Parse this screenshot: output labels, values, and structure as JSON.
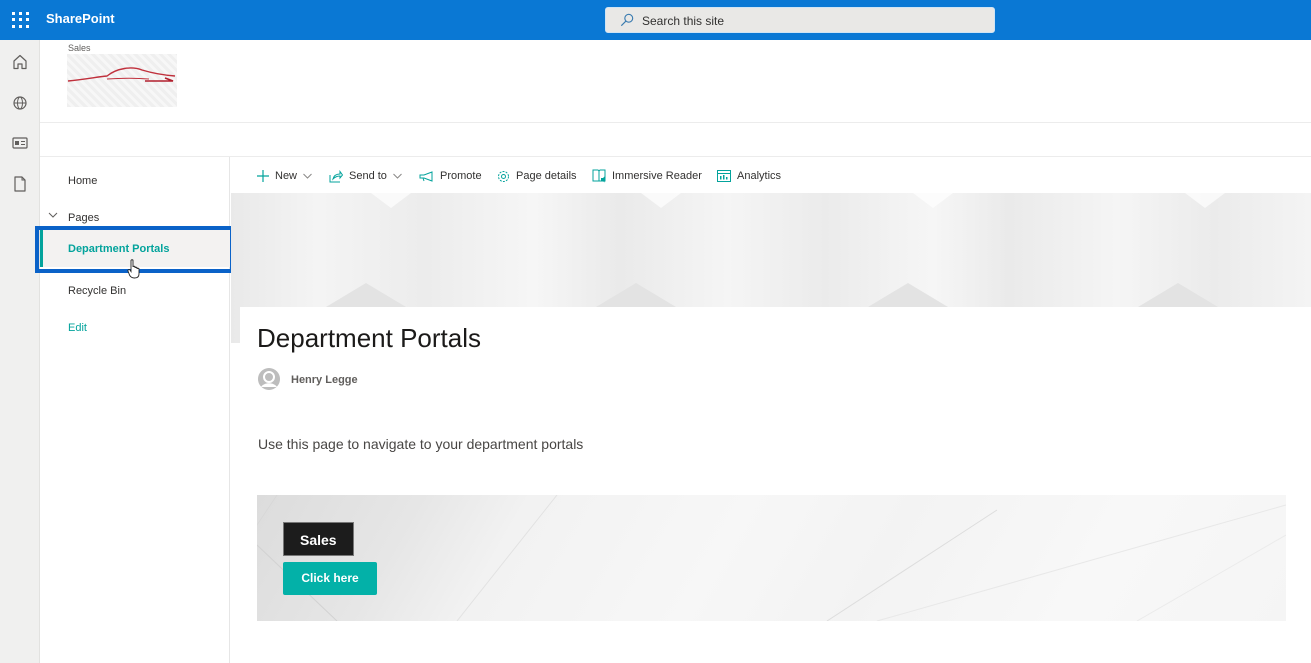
{
  "suitebar": {
    "app_name": "SharePoint",
    "search_placeholder": "Search this site",
    "brand_color": "#0a78d4"
  },
  "appbar": {
    "items": [
      {
        "icon": "home-icon",
        "label": "Home"
      },
      {
        "icon": "globe-icon",
        "label": "Sites"
      },
      {
        "icon": "news-icon",
        "label": "News"
      },
      {
        "icon": "document-icon",
        "label": "Files"
      }
    ]
  },
  "site": {
    "name": "Sales",
    "logo": "car-logo"
  },
  "leftnav": {
    "items": [
      {
        "label": "Home",
        "selected": false
      },
      {
        "label": "Pages",
        "selected": false,
        "expandable": true,
        "expanded": true
      },
      {
        "label": "Department Portals",
        "selected": true
      },
      {
        "label": "Recycle Bin",
        "selected": false
      },
      {
        "label": "Edit",
        "link": true
      }
    ],
    "accent_color": "#03a39c"
  },
  "commandbar": {
    "items": [
      {
        "label": "New",
        "icon": "plus-icon",
        "dropdown": true
      },
      {
        "label": "Send to",
        "icon": "share-icon",
        "dropdown": true
      },
      {
        "label": "Promote",
        "icon": "megaphone-icon"
      },
      {
        "label": "Page details",
        "icon": "gear-icon"
      },
      {
        "label": "Immersive Reader",
        "icon": "immersive-reader-icon"
      },
      {
        "label": "Analytics",
        "icon": "analytics-icon"
      }
    ]
  },
  "page": {
    "title": "Department Portals",
    "author": "Henry Legge",
    "intro": "Use this page to navigate to your department portals"
  },
  "section": {
    "title": "Sales",
    "button_label": "Click here",
    "button_color": "#03b1a8"
  }
}
